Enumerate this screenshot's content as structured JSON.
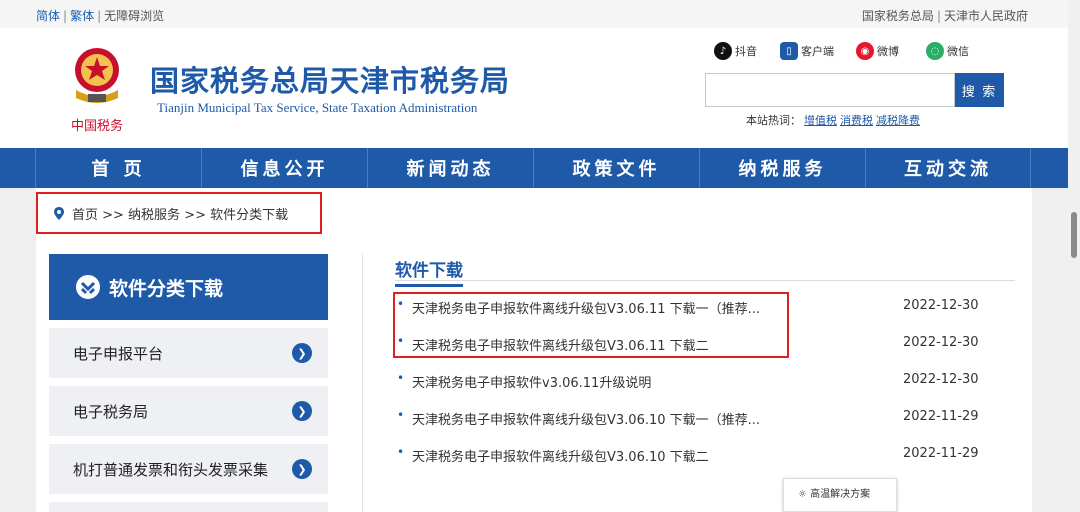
{
  "topbar": {
    "simplified": "简体",
    "traditional": "繁体",
    "accessible": "无障碍浏览",
    "right_link1": "国家税务总局",
    "right_link2": "天津市人民政府"
  },
  "header": {
    "title": "国家税务总局天津市税务局",
    "subtitle": "Tianjin Municipal Tax Service, State Taxation Administration",
    "emblem_text": "中国税务",
    "social": [
      "抖音",
      "客户端",
      "微博",
      "微信"
    ],
    "search_button": "搜 索",
    "search_placeholder": "",
    "hot_label": "本站热词：",
    "hot_words": [
      "增值税",
      "消费税",
      "减税降费"
    ]
  },
  "nav": [
    "首 页",
    "信息公开",
    "新闻动态",
    "政策文件",
    "纳税服务",
    "互动交流"
  ],
  "breadcrumb": "首页 >> 纳税服务 >> 软件分类下载",
  "sidebar": {
    "heading": "软件分类下载",
    "items": [
      "电子申报平台",
      "电子税务局",
      "机打普通发票和衔头发票采集"
    ]
  },
  "section": {
    "title": "软件下载",
    "rows": [
      {
        "title": "天津税务电子申报软件离线升级包V3.06.11 下载一（推荐...",
        "date": "2022-12-30"
      },
      {
        "title": "天津税务电子申报软件离线升级包V3.06.11 下载二",
        "date": "2022-12-30"
      },
      {
        "title": "天津税务电子申报软件v3.06.11升级说明",
        "date": "2022-12-30"
      },
      {
        "title": "天津税务电子申报软件离线升级包V3.06.10 下载一（推荐...",
        "date": "2022-11-29"
      },
      {
        "title": "天津税务电子申报软件离线升级包V3.06.10 下载二",
        "date": "2022-11-29"
      }
    ]
  },
  "popup": "高温解决方案",
  "colors": {
    "brand": "#1e5aa8",
    "highlight": "#e02020"
  }
}
